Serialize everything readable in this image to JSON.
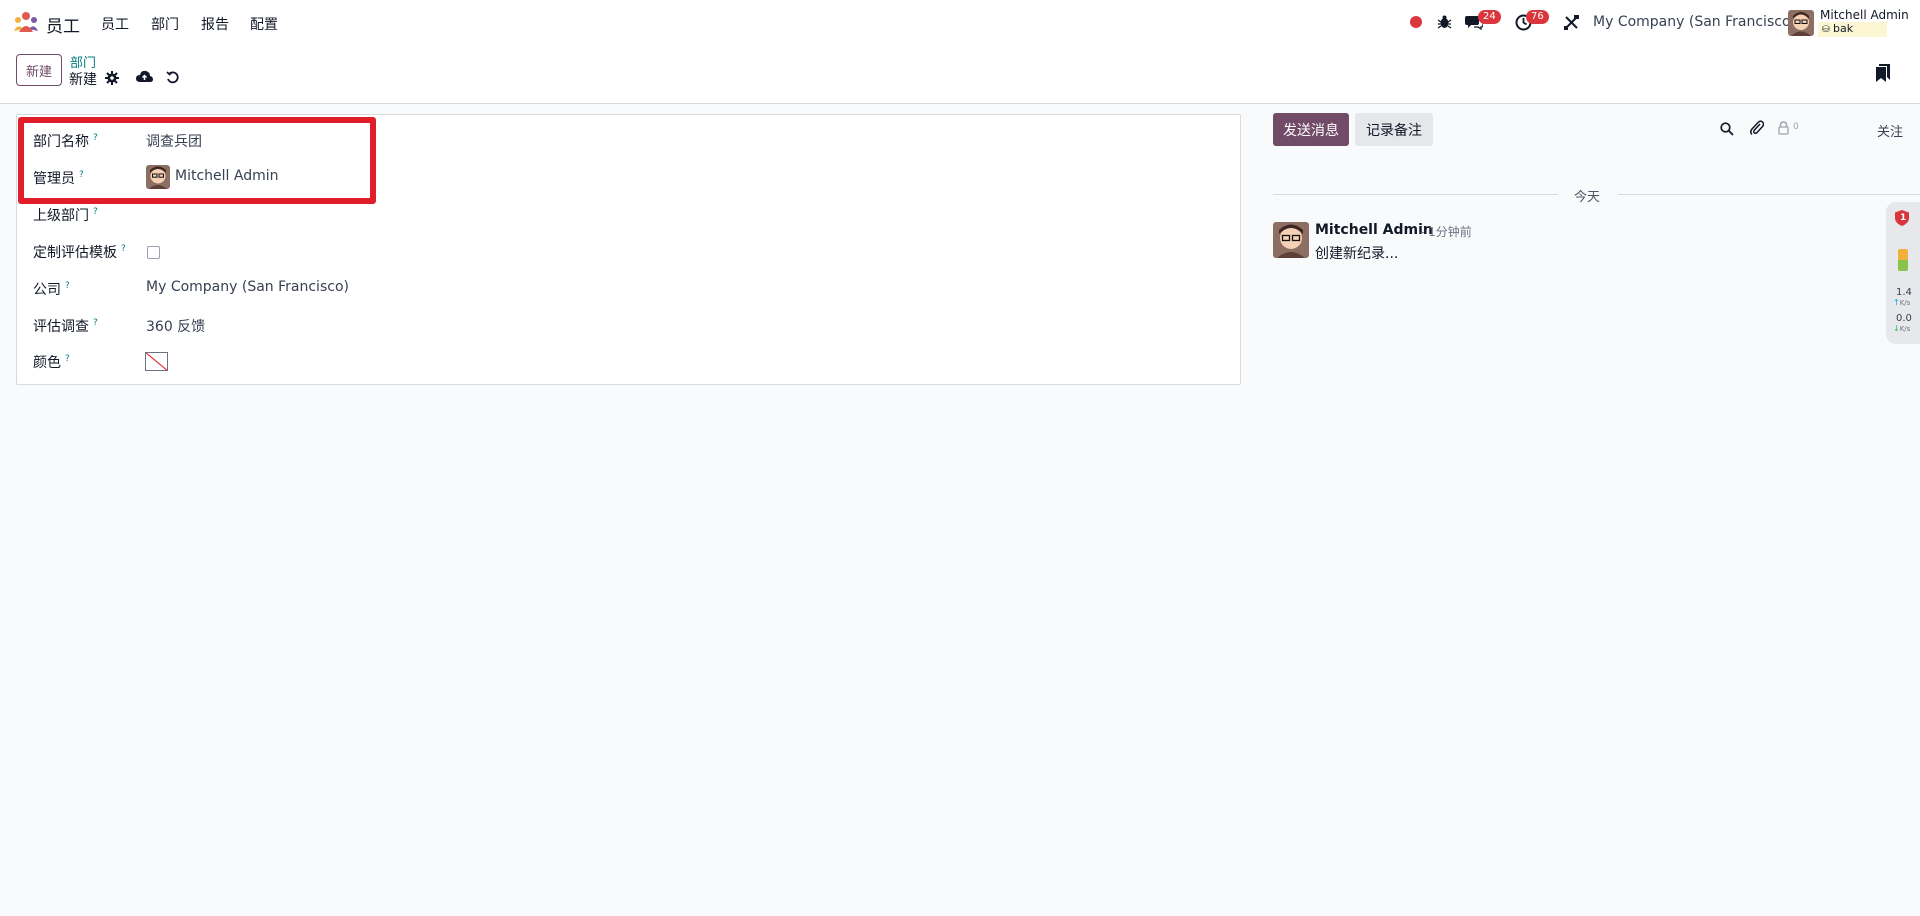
{
  "navbar": {
    "app_name": "员工",
    "menu": [
      "员工",
      "部门",
      "报告",
      "配置"
    ],
    "chat_badge": "24",
    "activity_badge": "76",
    "company": "My Company (San Francisco)",
    "user_name": "Mitchell Admin",
    "db_name": "bak"
  },
  "control_panel": {
    "new_button": "新建",
    "breadcrumb_parent": "部门",
    "breadcrumb_current": "新建"
  },
  "form": {
    "fields": [
      {
        "label": "部门名称",
        "help": "?",
        "value": "调查兵团"
      },
      {
        "label": "管理员",
        "help": "?",
        "value": "Mitchell Admin"
      },
      {
        "label": "上级部门",
        "help": "?",
        "value": ""
      },
      {
        "label": "定制评估模板",
        "help": "?",
        "value": ""
      },
      {
        "label": "公司",
        "help": "?",
        "value": "My Company (San Francisco)"
      },
      {
        "label": "评估调查",
        "help": "?",
        "value": "360 反馈"
      },
      {
        "label": "颜色",
        "help": "?",
        "value": ""
      }
    ]
  },
  "chatter": {
    "send_message": "发送消息",
    "log_note": "记录备注",
    "followers_count": "0",
    "follow": "关注",
    "date_separator": "今天",
    "messages": [
      {
        "author": "Mitchell Admin",
        "time": "- 1分钟前",
        "body": "创建新纪录..."
      }
    ]
  },
  "widget": {
    "alert_count": "1",
    "up_speed": "1.4",
    "down_speed": "0.0",
    "speed_unit": "K/s"
  },
  "colors": {
    "primary": "#714b67",
    "link": "#017e84",
    "badge": "#d9363e",
    "highlight": "#e11d2a"
  }
}
